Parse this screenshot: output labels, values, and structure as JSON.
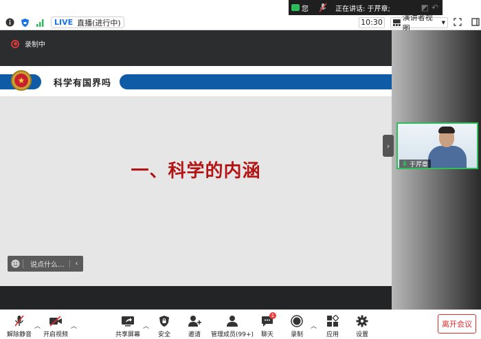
{
  "speaker_popup": {
    "self_label": "您",
    "speaking_text": "正在讲话: 于芹章;"
  },
  "toolbar": {
    "live_label": "LIVE",
    "live_status": "直播(进行中)",
    "timer": "10:30",
    "view_label": "演讲者视图"
  },
  "recording": {
    "label": "录制中"
  },
  "slide": {
    "title": "科学有国界吗",
    "heading": "一、科学的内涵"
  },
  "chat": {
    "placeholder": "说点什么..."
  },
  "video": {
    "participant_name": "于芹章"
  },
  "bottom_bar": {
    "unmute": "解除静音",
    "start_video": "开启视频",
    "share_screen": "共享屏幕",
    "security": "安全",
    "invite": "邀请",
    "manage_members": "管理成员(99+)",
    "chat": "聊天",
    "chat_badge": "1",
    "record": "录制",
    "apps": "应用",
    "settings": "设置",
    "leave": "离开会议"
  },
  "colors": {
    "accent_blue": "#0f5ba6",
    "heading_red": "#b31414",
    "speaking_green": "#2fbd5b",
    "leave_red": "#e02b2b"
  }
}
